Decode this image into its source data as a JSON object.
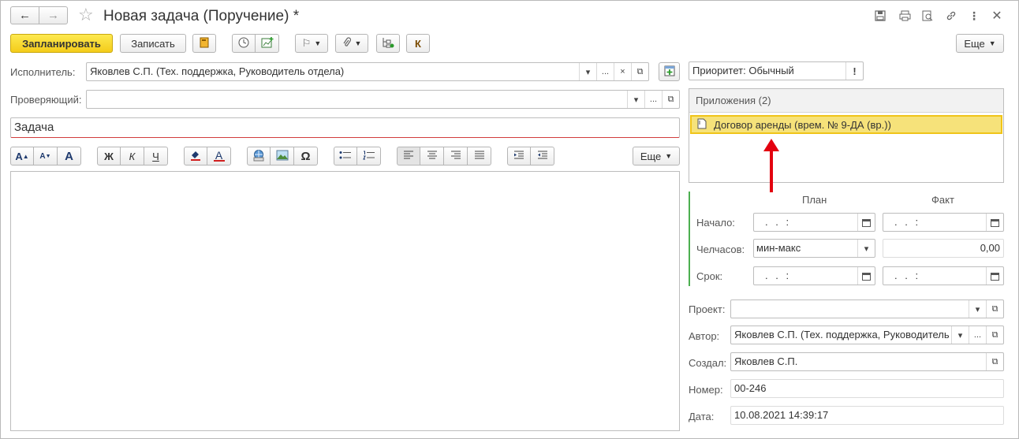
{
  "window": {
    "title": "Новая задача (Поручение) *"
  },
  "toolbar": {
    "plan_label": "Запланировать",
    "save_label": "Записать",
    "k_label": "К",
    "more_label": "Еще"
  },
  "form": {
    "executor_label": "Исполнитель:",
    "executor_value": "Яковлев С.П. (Тех. поддержка, Руководитель отдела)",
    "checker_label": "Проверяющий:",
    "checker_value": "",
    "task_placeholder": "Задача",
    "priority_value": "Приоритет: Обычный",
    "priority_mark": "!"
  },
  "format_toolbar": {
    "bold": "Ж",
    "italic": "К",
    "underline": "Ч",
    "omega": "Ω",
    "font_a": "A",
    "more_label": "Еще"
  },
  "attachments": {
    "header": "Приложения (2)",
    "items": [
      {
        "label": "Договор аренды (врем. № 9-ДА (вр.))"
      }
    ]
  },
  "schedule": {
    "plan_header": "План",
    "fact_header": "Факт",
    "start_label": "Начало:",
    "hours_label": "Челчасов:",
    "deadline_label": "Срок:",
    "date_mask": ". .   :",
    "hours_placeholder": "мин-макс",
    "hours_fact": "0,00"
  },
  "details": {
    "project_label": "Проект:",
    "project_value": "",
    "author_label": "Автор:",
    "author_value": "Яковлев С.П. (Тех. поддержка, Руководитель",
    "created_label": "Создал:",
    "created_value": "Яковлев С.П.",
    "number_label": "Номер:",
    "number_value": "00-246",
    "date_label": "Дата:",
    "date_value": "10.08.2021 14:39:17"
  },
  "field_buttons": {
    "dropdown": "▾",
    "ellipsis": "...",
    "clear": "×"
  },
  "colors": {
    "accent_yellow": "#f4cc1a",
    "highlight_row": "#f6e27a",
    "arrow_red": "#e3000f",
    "green_bar": "#4caf50"
  }
}
